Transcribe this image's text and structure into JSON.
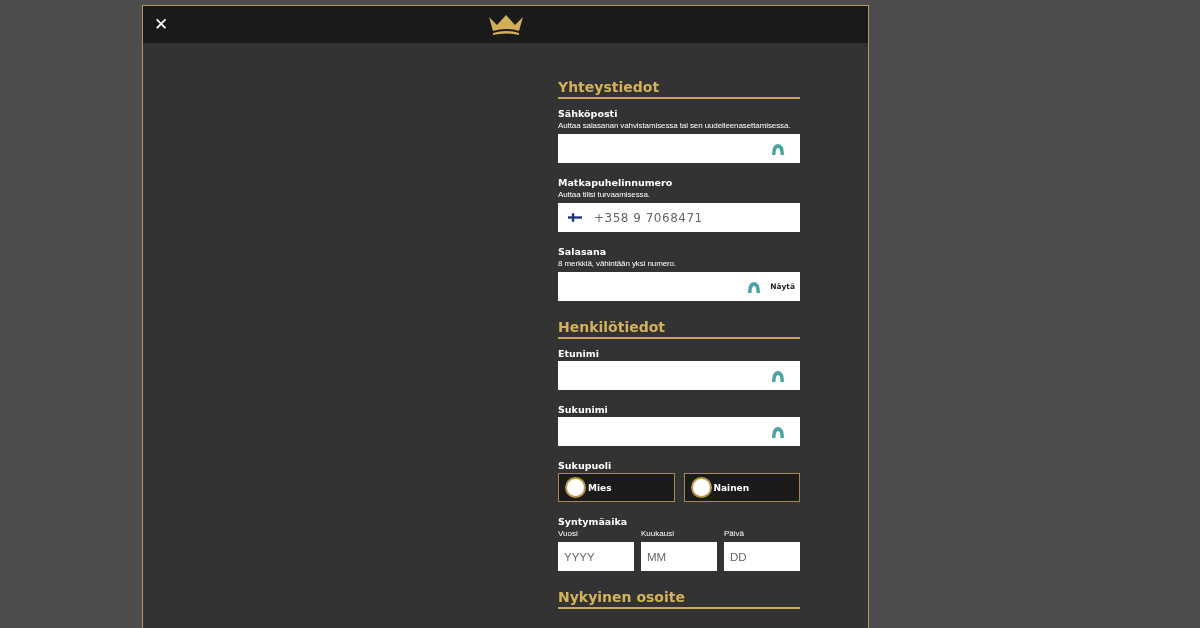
{
  "header": {
    "close_symbol": "✕"
  },
  "sections": [
    {
      "title": "Yhteystiedot",
      "fields": [
        {
          "kind": "text",
          "label": "Sähköposti",
          "hint": "Auttaa salasanan vahvistamisessa tai sen uudelleenasettamisessa."
        },
        {
          "kind": "phone",
          "label": "Matkapuhelinnumero",
          "hint": "Auttaa tilisi turvaamisessa.",
          "placeholder": "+358 9 7068471"
        },
        {
          "kind": "password",
          "label": "Salasana",
          "hint": "8 merkkiä, vähintään yksi numero.",
          "action": "Näytä"
        }
      ]
    },
    {
      "title": "Henkilötiedot",
      "fields": [
        {
          "kind": "text",
          "label": "Etunimi"
        },
        {
          "kind": "text",
          "label": "Sukunimi"
        },
        {
          "kind": "radio",
          "label": "Sukupuoli",
          "options": [
            {
              "label": "Mies",
              "selected": false
            },
            {
              "label": "Nainen",
              "selected": false
            }
          ]
        },
        {
          "kind": "date",
          "label": "Syntymäaika",
          "parts": [
            {
              "label": "Vuosi",
              "placeholder": "YYYY"
            },
            {
              "label": "Kuukausi",
              "placeholder": "MM"
            },
            {
              "label": "Päivä",
              "placeholder": "DD"
            }
          ]
        }
      ]
    },
    {
      "title": "Nykyinen osoite"
    }
  ]
}
